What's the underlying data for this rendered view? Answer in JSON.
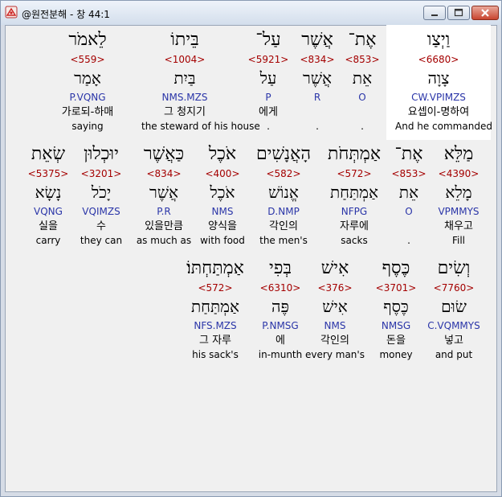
{
  "window": {
    "title": "@원전분해 - 창 44:1"
  },
  "icons": {
    "app": "app-icon",
    "minimize": "minimize-icon",
    "maximize": "maximize-icon",
    "close": "close-icon"
  },
  "rows": [
    {
      "words": [
        {
          "heb": "וַיְצַו",
          "num": "<6680>",
          "lemma": "צָוָה",
          "parse": "CW.VPIMZS",
          "korean": "요셉이-명하여",
          "eng": "And he commanded",
          "highlighted": true
        },
        {
          "heb": "אֶת־",
          "num": "<853>",
          "lemma": "אֵת",
          "parse": "O",
          "korean": "",
          "eng": "."
        },
        {
          "heb": "אֲשֶׁר",
          "num": "<834>",
          "lemma": "אֲשֶׁר",
          "parse": "R",
          "korean": "",
          "eng": "."
        },
        {
          "heb": "עַל־",
          "num": "<5921>",
          "lemma": "עַל",
          "parse": "P",
          "korean": "에게",
          "eng": "."
        },
        {
          "heb": "בֵּיתוֹ",
          "num": "<1004>",
          "lemma": "בַּיִת",
          "parse": "NMS.MZS",
          "korean": "그 청지기",
          "eng": "the steward of his house"
        },
        {
          "heb": "לֵאמֹר",
          "num": "<559>",
          "lemma": "אָמַר",
          "parse": "P.VQNG",
          "korean": "가로되-하매",
          "eng": "saying"
        }
      ]
    },
    {
      "words": [
        {
          "heb": "מַלֵּא",
          "num": "<4390>",
          "lemma": "מָלֵא",
          "parse": "VPMMYS",
          "korean": "채우고",
          "eng": "Fill"
        },
        {
          "heb": "אֶת־",
          "num": "<853>",
          "lemma": "אֵת",
          "parse": "O",
          "korean": "",
          "eng": "."
        },
        {
          "heb": "אַמְתְּחֹת",
          "num": "<572>",
          "lemma": "אַמְתַּחַת",
          "parse": "NFPG",
          "korean": "자루에",
          "eng": "sacks"
        },
        {
          "heb": "הָאֲנָשִׁים",
          "num": "<582>",
          "lemma": "אֱנוֹשׁ",
          "parse": "D.NMP",
          "korean": "각인의",
          "eng": "the men's"
        },
        {
          "heb": "אֹכֶל",
          "num": "<400>",
          "lemma": "אֹכֶל",
          "parse": "NMS",
          "korean": "양식을",
          "eng": "with food"
        },
        {
          "heb": "כַּאֲשֶׁר",
          "num": "<834>",
          "lemma": "אֲשֶׁר",
          "parse": "P.R",
          "korean": "있을만큼",
          "eng": "as much as"
        },
        {
          "heb": "יוּכְלוּן",
          "num": "<3201>",
          "lemma": "יָכֹל",
          "parse": "VQIMZS",
          "korean": "수",
          "eng": "they can"
        },
        {
          "heb": "שְׂאֵת",
          "num": "<5375>",
          "lemma": "נָשָׂא",
          "parse": "VQNG",
          "korean": "실을",
          "eng": "carry"
        }
      ]
    },
    {
      "words": [
        {
          "heb": "וְשִׂים",
          "num": "<7760>",
          "lemma": "שׂוּם",
          "parse": "C.VQMMYS",
          "korean": "넣고",
          "eng": "and put"
        },
        {
          "heb": "כֶּסֶף",
          "num": "<3701>",
          "lemma": "כֶּסֶף",
          "parse": "NMSG",
          "korean": "돈을",
          "eng": "money"
        },
        {
          "heb": "אִישׁ",
          "num": "<376>",
          "lemma": "אִישׁ",
          "parse": "NMS",
          "korean": "각인의",
          "eng": "every man's"
        },
        {
          "heb": "בְּפִי",
          "num": "<6310>",
          "lemma": "פֶּה",
          "parse": "P.NMSG",
          "korean": "에",
          "eng": "in-munth"
        },
        {
          "heb": "אַמְתַּחְתּוֹ׃",
          "num": "<572>",
          "lemma": "אַמְתַּחַת",
          "parse": "NFS.MZS",
          "korean": "그 자루",
          "eng": "his sack's"
        }
      ]
    }
  ]
}
